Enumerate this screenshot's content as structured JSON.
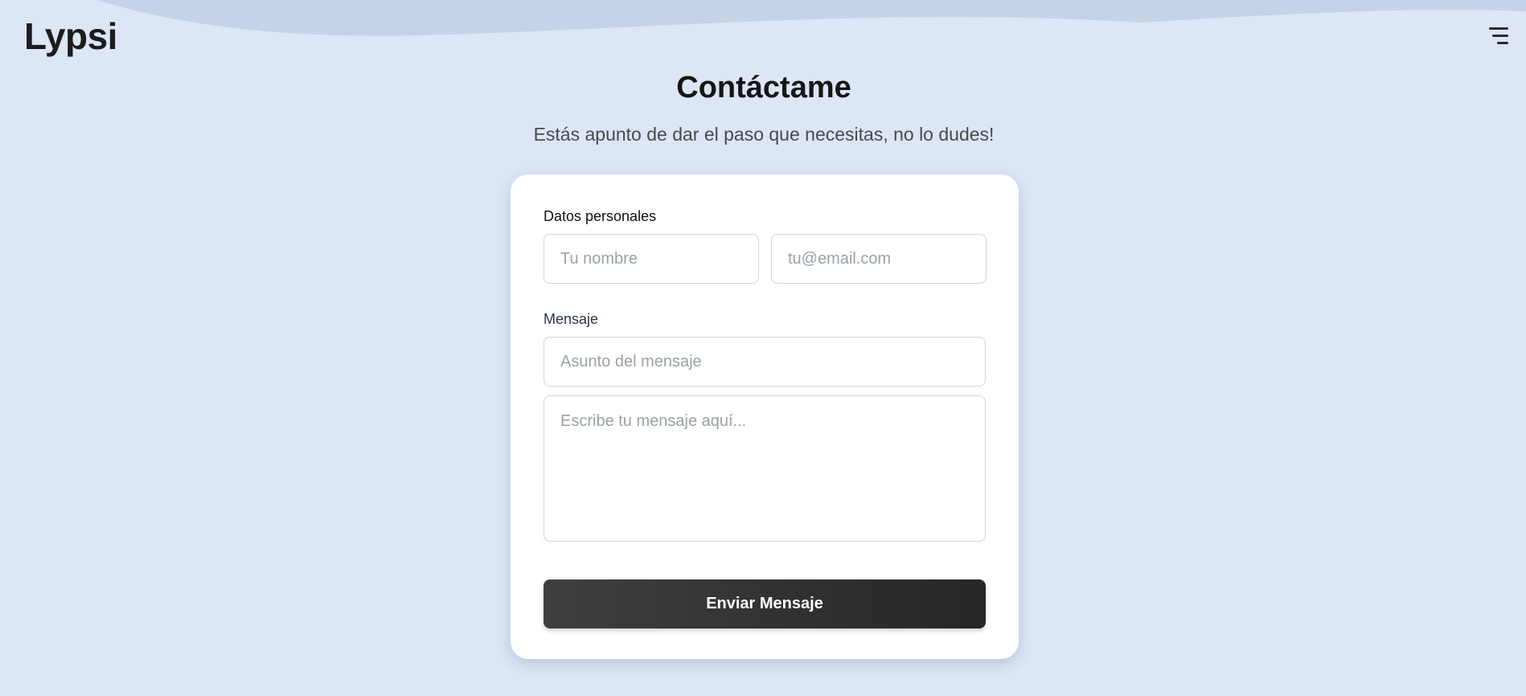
{
  "header": {
    "logo": "Lypsi",
    "menu_icon": "hamburger-menu-icon"
  },
  "hero": {
    "title": "Contáctame",
    "subtitle": "Estás apunto de dar el paso que necesitas, no lo dudes!"
  },
  "form": {
    "personal_label": "Datos personales",
    "name_placeholder": "Tu nombre",
    "email_placeholder": "tu@email.com",
    "message_label": "Mensaje",
    "subject_placeholder": "Asunto del mensaje",
    "message_placeholder": "Escribe tu mensaje aquí...",
    "submit_label": "Enviar Mensaje"
  },
  "colors": {
    "background": "#dce6f5",
    "wave": "#c3d3e8",
    "card": "#ffffff",
    "button": "#333333"
  }
}
